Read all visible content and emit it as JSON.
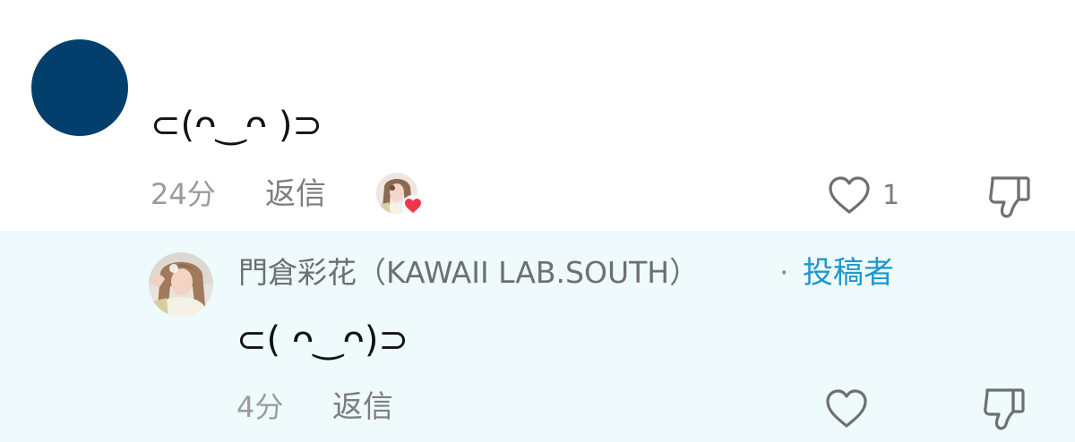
{
  "comment": {
    "text": "⊂(ᴖ‿ᴖ )⊃",
    "time": "24分",
    "reply_label": "返信",
    "like_count": "1",
    "creator_liked": true
  },
  "reply": {
    "author": "門倉彩花（KAWAII LAB.SOUTH）",
    "separator": "·",
    "badge": "投稿者",
    "text": "⊂( ᴖ‿ᴖ)⊃",
    "time": "4分",
    "reply_label": "返信"
  },
  "colors": {
    "avatar": "#033f6d",
    "accent_blue": "#1e97d2",
    "reply_background": "#eefafb",
    "heart_red": "#f3344f"
  },
  "icons": {
    "like": "heart-outline-icon",
    "dislike": "thumbs-down-outline-icon",
    "creator_heart": "heart-filled-icon"
  }
}
